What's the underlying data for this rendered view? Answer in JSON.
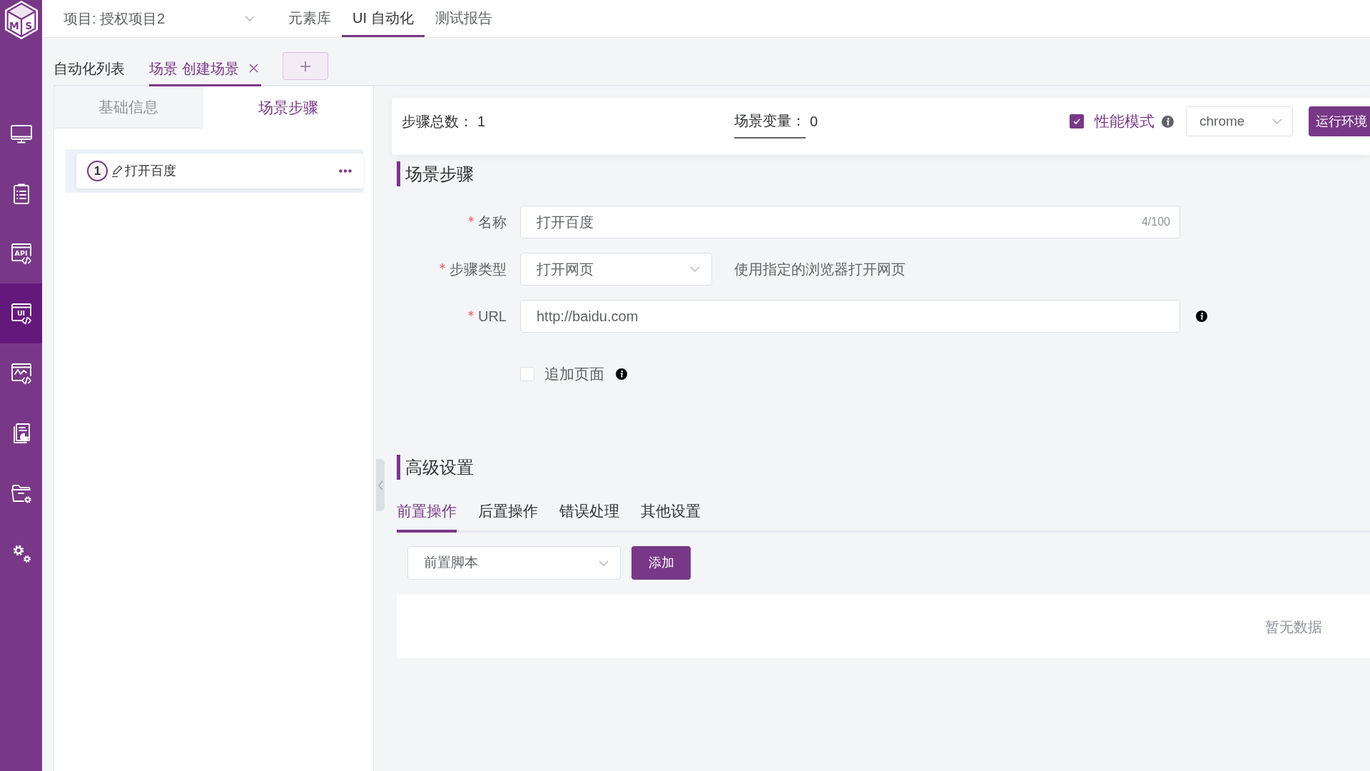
{
  "logo": {
    "letters": [
      "M",
      "S"
    ]
  },
  "sidebar": {
    "items": [
      {
        "selected": false
      },
      {
        "selected": false
      },
      {
        "icon_text": "API",
        "selected": false
      },
      {
        "icon_text": "UI",
        "selected": true
      },
      {
        "selected": false
      },
      {
        "selected": false
      },
      {
        "selected": false
      },
      {
        "selected": false
      }
    ]
  },
  "header": {
    "project": "项目: 授权项目2",
    "nav": [
      {
        "label": "元素库",
        "selected": false
      },
      {
        "label": "UI 自动化",
        "selected": true
      },
      {
        "label": "测试报告",
        "selected": false
      }
    ]
  },
  "tabs": [
    {
      "label": "自动化列表",
      "selected": false,
      "closable": false
    },
    {
      "label": "场景 创建场景",
      "selected": true,
      "closable": true
    }
  ],
  "left_panel": {
    "tabs": [
      {
        "label": "基础信息",
        "selected": false
      },
      {
        "label": "场景步骤",
        "selected": true
      }
    ],
    "steps": [
      {
        "number": "1",
        "name": "打开百度",
        "selected": true
      }
    ]
  },
  "summary": {
    "step_total": {
      "label": "步骤总数：",
      "value": "1"
    },
    "variables": {
      "label": "场景变量：",
      "value": "0"
    },
    "performance_mode": {
      "label": "性能模式",
      "checked": true
    },
    "browser": "chrome",
    "run_button": "运行环境"
  },
  "step_form": {
    "title": "场景步骤",
    "fields": [
      {
        "kind": "input",
        "label": "名称",
        "required": true,
        "value": "打开百度",
        "counter": "4/100"
      },
      {
        "kind": "select",
        "label": "步骤类型",
        "required": true,
        "value": "打开网页",
        "hint": "使用指定的浏览器打开网页"
      },
      {
        "kind": "input",
        "label": "URL",
        "required": true,
        "value": "http://baidu.com",
        "info": true
      }
    ],
    "append_page": {
      "label": "追加页面",
      "checked": false
    }
  },
  "advanced": {
    "title": "高级设置",
    "tabs": [
      {
        "label": "前置操作",
        "selected": true
      },
      {
        "label": "后置操作",
        "selected": false
      },
      {
        "label": "错误处理",
        "selected": false
      },
      {
        "label": "其他设置",
        "selected": false
      }
    ],
    "script_type": "前置脚本",
    "add_button": "添加",
    "empty_text": "暂无数据"
  }
}
